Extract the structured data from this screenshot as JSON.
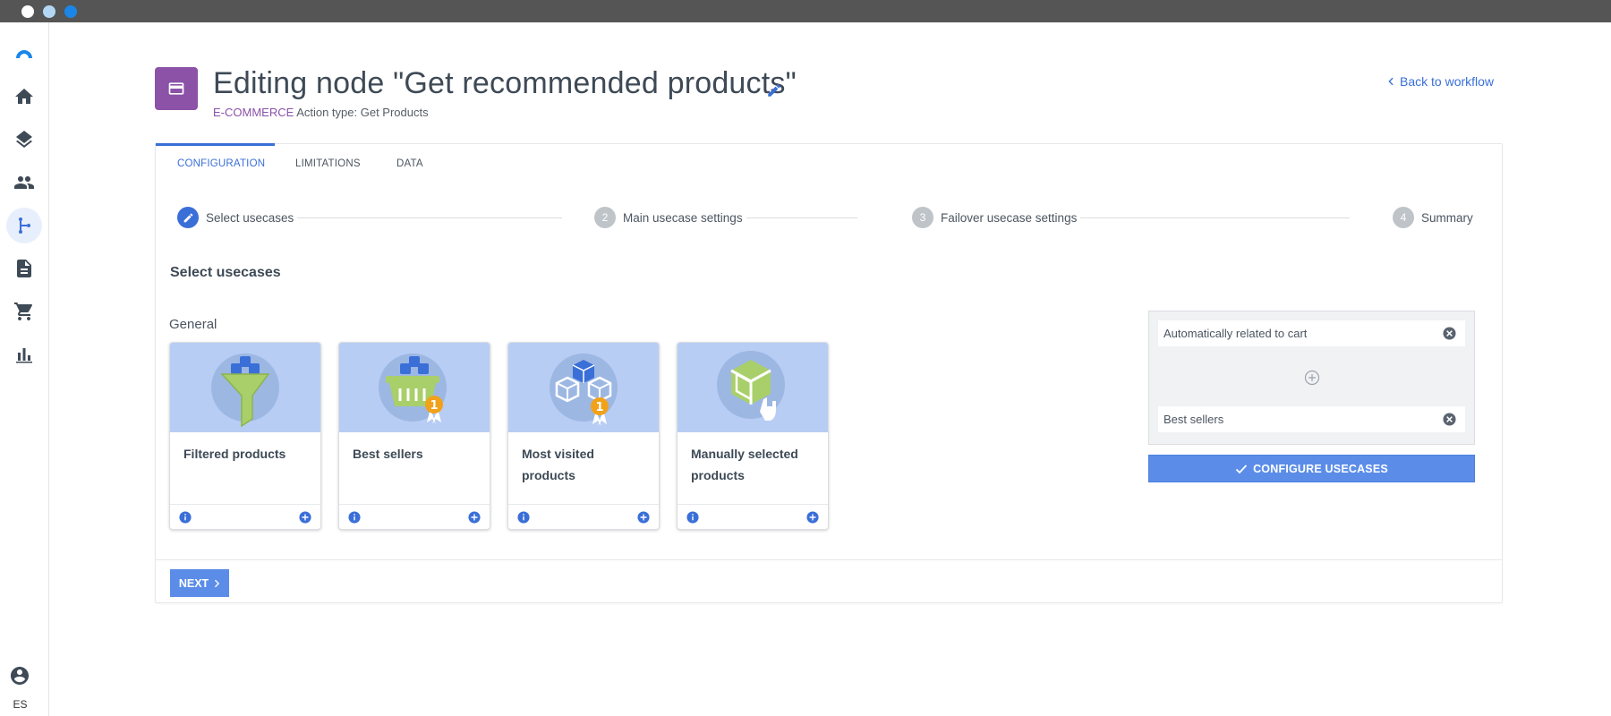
{
  "window": {
    "traffic_lights": [
      {
        "name": "close",
        "color": "#ffffff"
      },
      {
        "name": "minimize",
        "color": "#b3d8f5"
      },
      {
        "name": "maximize",
        "color": "#1a86e8"
      }
    ]
  },
  "sidebar": {
    "logo": "brand-logo",
    "items": [
      {
        "name": "home",
        "icon": "home-icon"
      },
      {
        "name": "layers",
        "icon": "layers-icon"
      },
      {
        "name": "people",
        "icon": "people-icon"
      },
      {
        "name": "workflows",
        "icon": "workflow-branch-icon",
        "active": true
      },
      {
        "name": "documents",
        "icon": "document-icon"
      },
      {
        "name": "cart",
        "icon": "cart-icon"
      },
      {
        "name": "analytics",
        "icon": "bar-chart-icon"
      }
    ],
    "language": "ES"
  },
  "header": {
    "icon": "card-icon",
    "title": "Editing node \"Get recommended products\"",
    "category": "E-COMMERCE",
    "action_type": "Action type: Get Products",
    "back_link": "Back to workflow"
  },
  "tabs": [
    {
      "label": "CONFIGURATION",
      "active": true
    },
    {
      "label": "LIMITATIONS"
    },
    {
      "label": "DATA"
    }
  ],
  "stepper": [
    {
      "number": "1",
      "label": "Select usecases",
      "active": true
    },
    {
      "number": "2",
      "label": "Main usecase settings"
    },
    {
      "number": "3",
      "label": "Failover usecase settings"
    },
    {
      "number": "4",
      "label": "Summary"
    }
  ],
  "section": {
    "title": "Select usecases",
    "group_label": "General"
  },
  "usecases": [
    {
      "name": "Filtered products",
      "art": "funnel-boxes-icon"
    },
    {
      "name": "Best sellers",
      "art": "basket-medal-icon"
    },
    {
      "name": "Most visited products",
      "art": "boxes-medal-icon"
    },
    {
      "name": "Manually selected products",
      "art": "box-hand-icon"
    }
  ],
  "selected": {
    "items": [
      "Automatically related to cart",
      "Best sellers"
    ],
    "configure_label": "CONFIGURE USECASES"
  },
  "footer": {
    "next_label": "NEXT"
  },
  "colors": {
    "accent": "#3a6fd8",
    "button": "#5b8de8",
    "category": "#8b52a8",
    "card_art_bg": "#b7cdf4"
  }
}
